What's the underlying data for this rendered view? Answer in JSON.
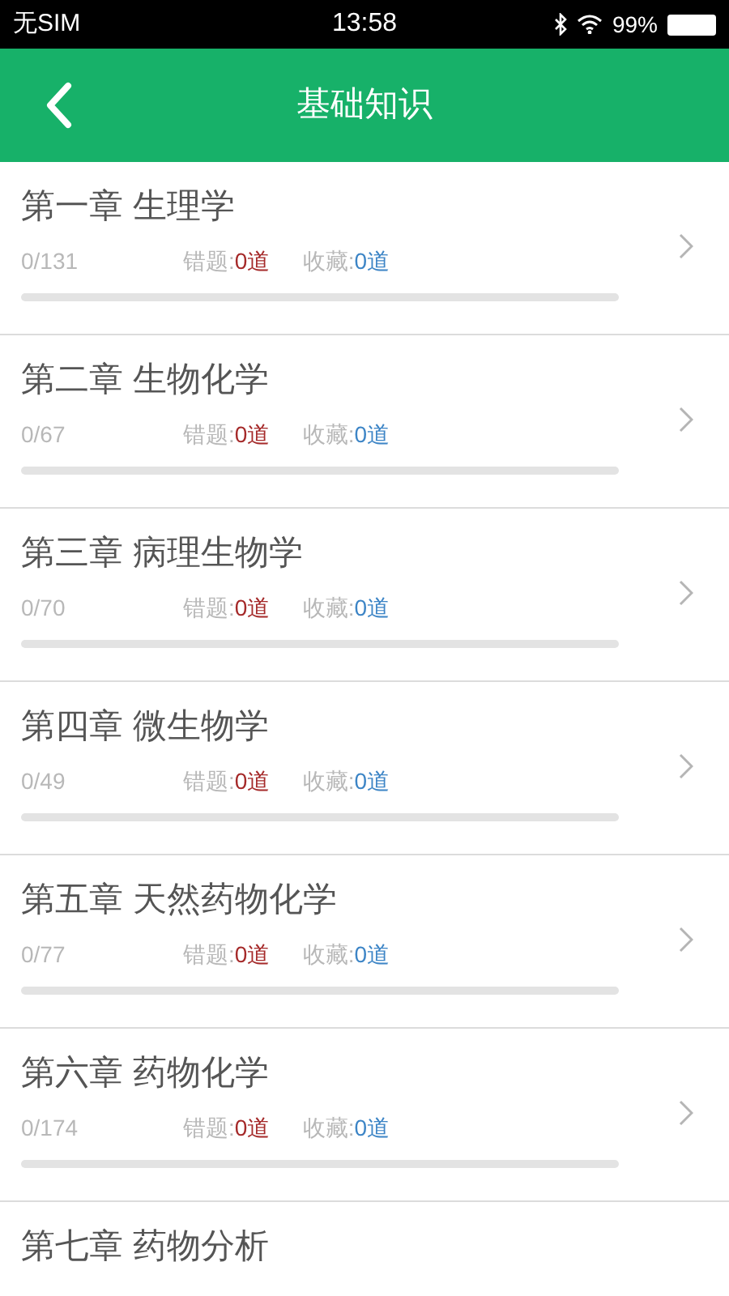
{
  "status_bar": {
    "carrier": "无SIM",
    "time": "13:58",
    "battery": "99%"
  },
  "header": {
    "title": "基础知识"
  },
  "chapters": [
    {
      "title": "第一章 生理学",
      "progress": "0/131",
      "wrong_label": "错题:",
      "wrong_value": "0道",
      "fav_label": "收藏:",
      "fav_value": "0道",
      "level": 0
    },
    {
      "title": "第二章 生物化学",
      "progress": "0/67",
      "wrong_label": "错题:",
      "wrong_value": "0道",
      "fav_label": "收藏:",
      "fav_value": "0道",
      "level": 0
    },
    {
      "title": "第三章 病理生物学",
      "progress": "0/70",
      "wrong_label": "错题:",
      "wrong_value": "0道",
      "fav_label": "收藏:",
      "fav_value": "0道",
      "level": 0
    },
    {
      "title": "第四章 微生物学",
      "progress": "0/49",
      "wrong_label": "错题:",
      "wrong_value": "0道",
      "fav_label": "收藏:",
      "fav_value": "0道",
      "level": 0
    },
    {
      "title": "第五章 天然药物化学",
      "progress": "0/77",
      "wrong_label": "错题:",
      "wrong_value": "0道",
      "fav_label": "收藏:",
      "fav_value": "0道",
      "level": 0
    },
    {
      "title": "第六章 药物化学",
      "progress": "0/174",
      "wrong_label": "错题:",
      "wrong_value": "0道",
      "fav_label": "收藏:",
      "fav_value": "0道",
      "level": 0
    },
    {
      "title": "第七章 药物分析"
    }
  ]
}
